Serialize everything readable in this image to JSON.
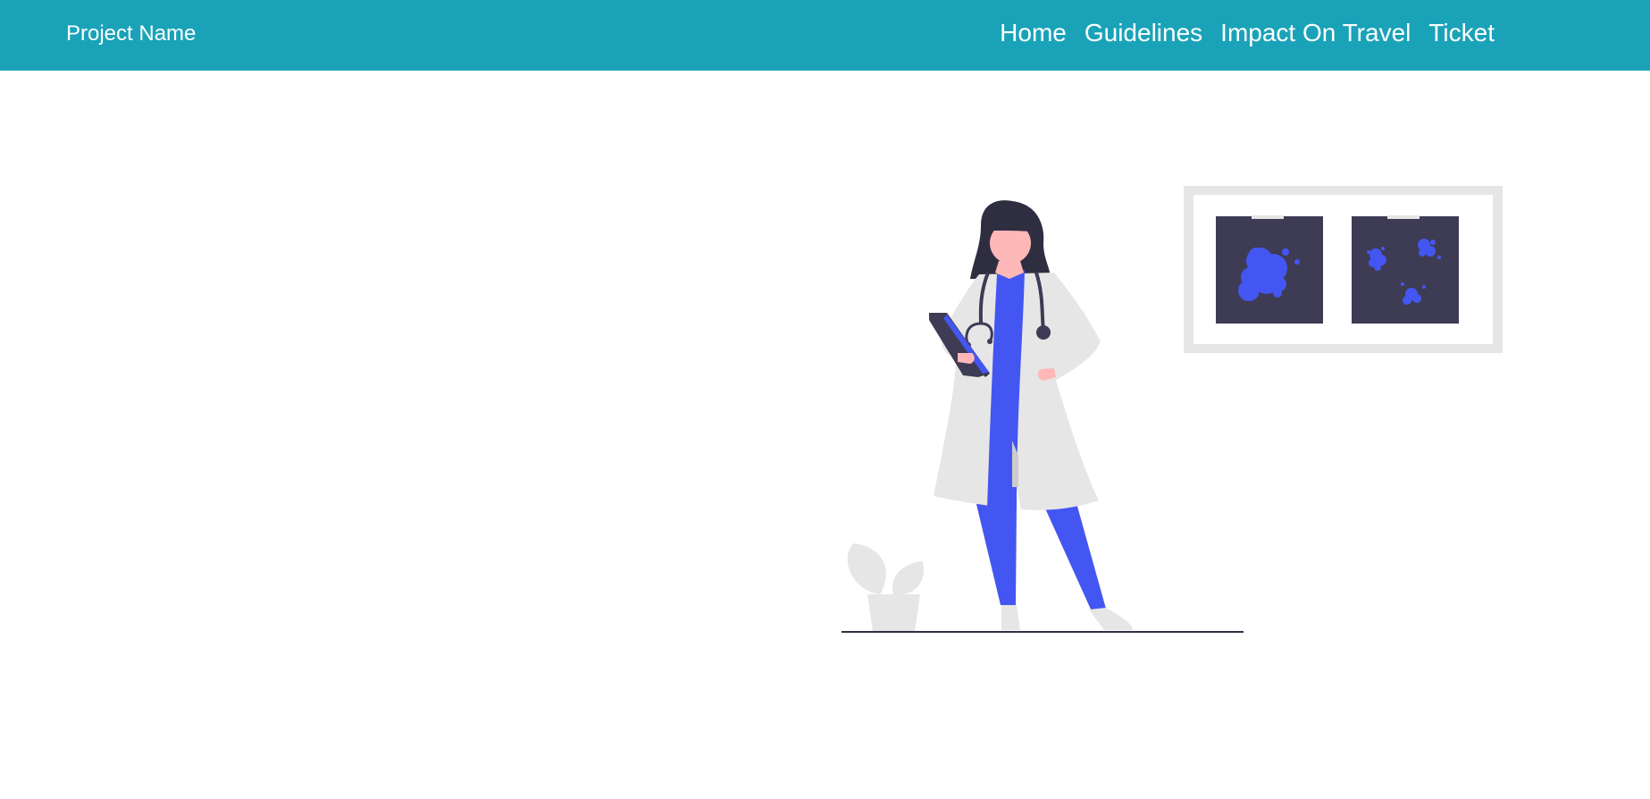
{
  "navbar": {
    "brand": "Project Name",
    "links": [
      {
        "label": "Home"
      },
      {
        "label": "Guidelines"
      },
      {
        "label": "Impact On Travel"
      },
      {
        "label": "Ticket"
      }
    ]
  },
  "colors": {
    "navbar_bg": "#1aa3b8",
    "accent": "#4456f2",
    "dark": "#3e3b54",
    "light_gray": "#e6e6e6",
    "skin": "#ffb8b8",
    "hair": "#2f2e41"
  },
  "illustration": {
    "subject": "doctor-with-clipboard-and-xray-frame"
  }
}
